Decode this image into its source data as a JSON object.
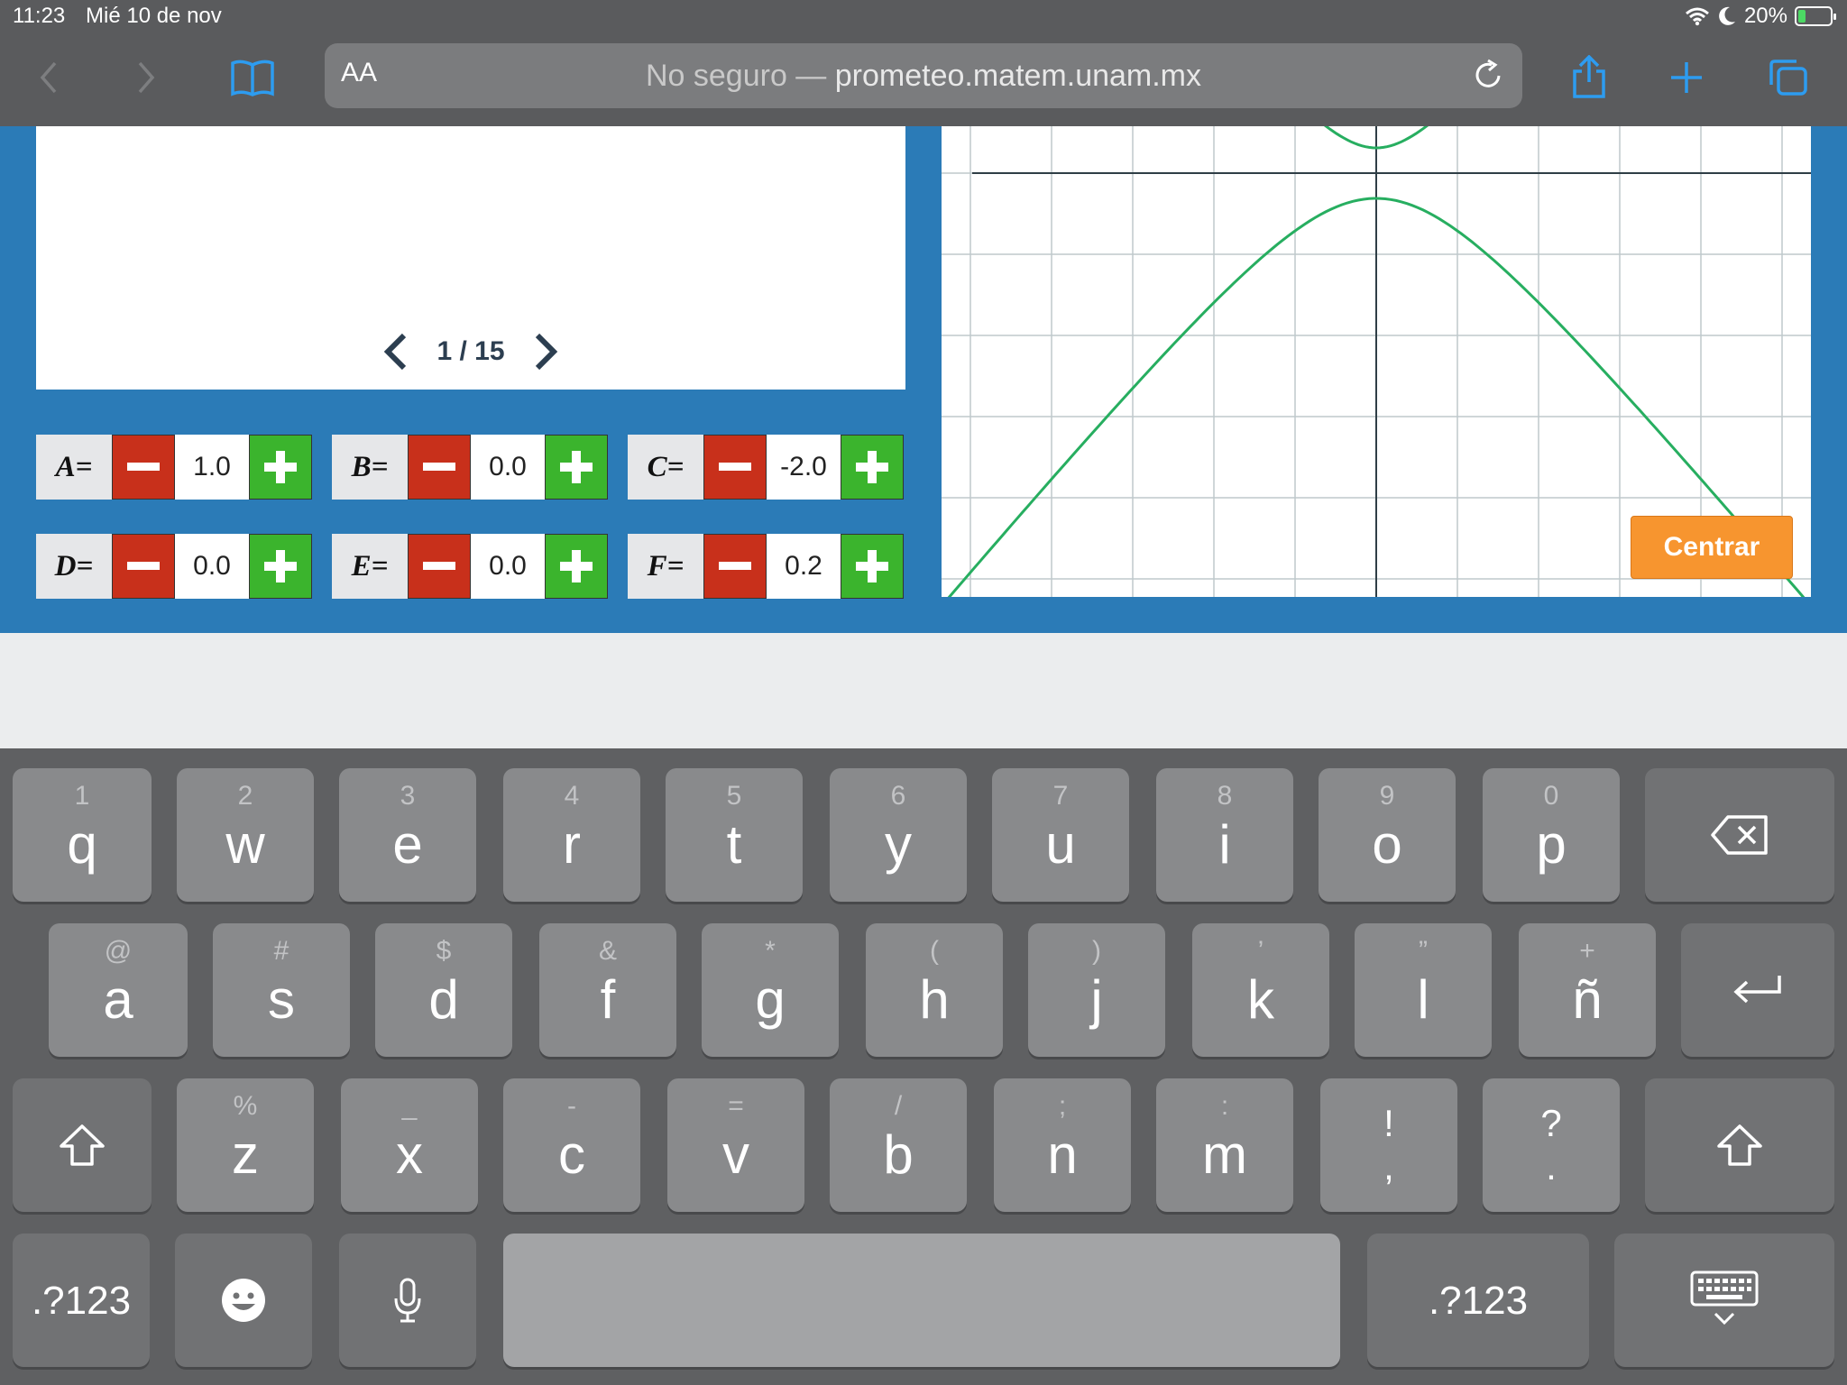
{
  "status_bar": {
    "time": "11:23",
    "date": "Mié 10 de nov",
    "battery": "20%"
  },
  "safari": {
    "aa_label": "AA",
    "url_prefix": "No seguro — ",
    "url_domain": "prometeo.matem.unam.mx"
  },
  "slide": {
    "page_indicator": "1 / 15"
  },
  "params": [
    {
      "label": "A=",
      "value": "1.0"
    },
    {
      "label": "B=",
      "value": "0.0"
    },
    {
      "label": "C=",
      "value": "-2.0"
    },
    {
      "label": "D=",
      "value": "0.0"
    },
    {
      "label": "E=",
      "value": "0.0"
    },
    {
      "label": "F=",
      "value": "0.2"
    }
  ],
  "graph": {
    "centrar_label": "Centrar",
    "curve_color": "#27ae60",
    "grid_color": "#bfc9cc"
  },
  "keyboard": {
    "row1": [
      {
        "sec": "1",
        "pri": "q"
      },
      {
        "sec": "2",
        "pri": "w"
      },
      {
        "sec": "3",
        "pri": "e"
      },
      {
        "sec": "4",
        "pri": "r"
      },
      {
        "sec": "5",
        "pri": "t"
      },
      {
        "sec": "6",
        "pri": "y"
      },
      {
        "sec": "7",
        "pri": "u"
      },
      {
        "sec": "8",
        "pri": "i"
      },
      {
        "sec": "9",
        "pri": "o"
      },
      {
        "sec": "0",
        "pri": "p"
      }
    ],
    "row2": [
      {
        "sec": "@",
        "pri": "a"
      },
      {
        "sec": "#",
        "pri": "s"
      },
      {
        "sec": "$",
        "pri": "d"
      },
      {
        "sec": "&",
        "pri": "f"
      },
      {
        "sec": "*",
        "pri": "g"
      },
      {
        "sec": "(",
        "pri": "h"
      },
      {
        "sec": ")",
        "pri": "j"
      },
      {
        "sec": "’",
        "pri": "k"
      },
      {
        "sec": "”",
        "pri": "l"
      },
      {
        "sec": "+",
        "pri": "ñ"
      }
    ],
    "row3": [
      {
        "sec": "%",
        "pri": "z"
      },
      {
        "sec": "_",
        "pri": "x"
      },
      {
        "sec": "-",
        "pri": "c"
      },
      {
        "sec": "=",
        "pri": "v"
      },
      {
        "sec": "/",
        "pri": "b"
      },
      {
        "sec": ";",
        "pri": "n"
      },
      {
        "sec": ":",
        "pri": "m"
      }
    ],
    "punct": [
      {
        "top": "!",
        "bot": ","
      },
      {
        "top": "?",
        "bot": "."
      }
    ],
    "numbers_label": ".?123"
  }
}
